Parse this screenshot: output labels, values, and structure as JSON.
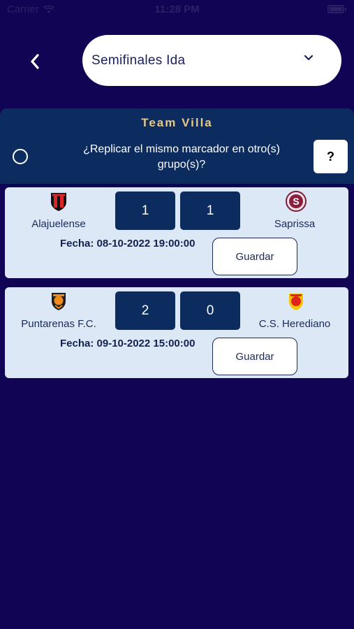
{
  "status_bar": {
    "carrier": "Carrier",
    "time": "11:28 PM"
  },
  "header": {
    "phase_selected": "Semifinales Ida"
  },
  "team_panel": {
    "title": "Team Villa",
    "replicate_line1": "¿Replicar el mismo marcador en otro(s)",
    "replicate_line2": "grupo(s)?",
    "help_label": "?"
  },
  "matches": [
    {
      "home_team": "Alajuelense",
      "away_team": "Saprissa",
      "home_score": "1",
      "away_score": "1",
      "date": "Fecha: 08-10-2022 19:00:00",
      "save_label": "Guardar"
    },
    {
      "home_team": "Puntarenas F.C.",
      "away_team": "C.S. Herediano",
      "home_score": "2",
      "away_score": "0",
      "date": "Fecha: 09-10-2022 15:00:00",
      "save_label": "Guardar"
    }
  ],
  "colors": {
    "background": "#120454",
    "panel": "#0c2c60",
    "card": "#dde8f6",
    "accent_gold": "#e6c88a"
  }
}
